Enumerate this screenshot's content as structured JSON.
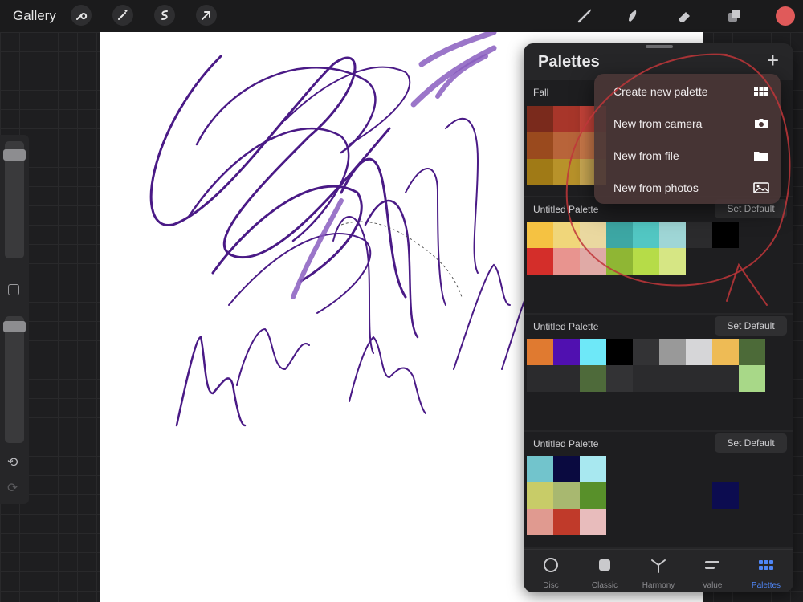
{
  "topbar": {
    "gallery_label": "Gallery",
    "left_tools": [
      "wrench-icon",
      "magic-wand-icon",
      "selection-icon",
      "transform-arrow-icon"
    ],
    "right_tools": [
      "brush-icon",
      "smudge-icon",
      "eraser-icon",
      "layers-icon"
    ],
    "current_color": "#e05a5a"
  },
  "panel": {
    "title": "Palettes",
    "add_icon": "plus-icon",
    "palettes": [
      {
        "name": "Fall",
        "default_label": ""
      },
      {
        "name": "Untitled Palette",
        "default_label": "Set Default"
      },
      {
        "name": "Untitled Palette",
        "default_label": "Set Default"
      },
      {
        "name": "Untitled Palette",
        "default_label": "Set Default"
      }
    ]
  },
  "menu": {
    "items": [
      {
        "label": "Create new palette",
        "icon": "grid-icon"
      },
      {
        "label": "New from camera",
        "icon": "camera-icon"
      },
      {
        "label": "New from file",
        "icon": "folder-icon"
      },
      {
        "label": "New from photos",
        "icon": "photo-icon"
      }
    ]
  },
  "tabs": [
    {
      "label": "Disc",
      "icon": "disc-icon",
      "active": false
    },
    {
      "label": "Classic",
      "icon": "classic-icon",
      "active": false
    },
    {
      "label": "Harmony",
      "icon": "harmony-icon",
      "active": false
    },
    {
      "label": "Value",
      "icon": "value-icon",
      "active": false
    },
    {
      "label": "Palettes",
      "icon": "palettes-icon",
      "active": true
    }
  ],
  "colors": {
    "accent": "#4f86f7",
    "fall": [
      "#7a2a1c",
      "#a8362a",
      "#c8443a",
      "#9a4a1e",
      "#b8643a",
      "#cc7a4a",
      "#a07a16",
      "#b8922a",
      "#ccaa54"
    ],
    "palette1_row1": [
      "#f5c242",
      "#f0d67a",
      "#ead8a0",
      "#3da7a4",
      "#52c7c3",
      "#9fd6d6",
      "",
      "#000000"
    ],
    "palette1_row2": [
      "#d42e2a",
      "#e8948f",
      "#e0aaa6",
      "#8fb634",
      "#b6dc48",
      "#d6e684"
    ],
    "palette2_row1": [
      "#e07a30",
      "#5010b0",
      "#6ee8f8",
      "#000000",
      "#333335",
      "#999999",
      "#d6d6d8",
      "#eebb55",
      "#4c6a38"
    ],
    "palette2_row2": [
      "",
      "",
      "#4e6a3a",
      "#333335",
      "",
      "",
      "",
      "",
      "#a8d888"
    ],
    "palette3_rows": [
      [
        "#72c4cc",
        "#0a0a40",
        "#a8e8f0"
      ],
      [
        "#c8cc68",
        "#a8b870",
        "#58902a"
      ],
      [
        "#e09a90",
        "#c03a2a",
        "#e8bcbc"
      ]
    ],
    "palette3_extra": "#0c0c50"
  }
}
